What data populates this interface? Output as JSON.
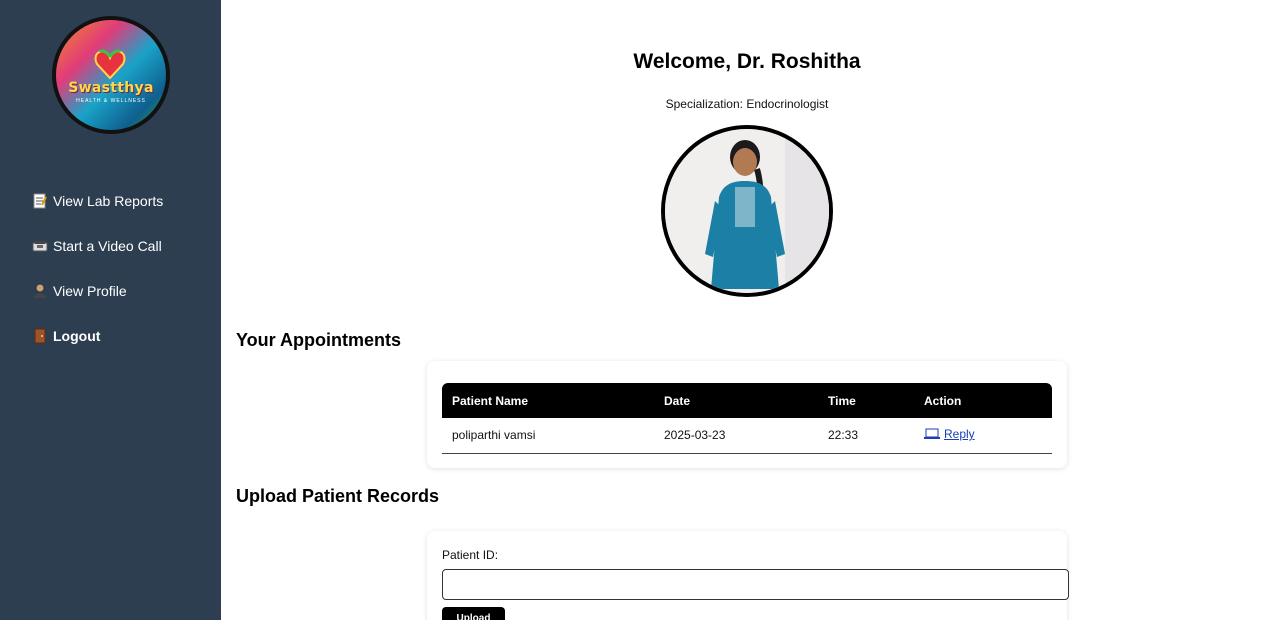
{
  "sidebar": {
    "logo": {
      "brand": "Swastthya",
      "tagline": "HEALTH & WELLNESS"
    },
    "items": [
      {
        "label": "View Lab Reports",
        "icon": "memo-icon"
      },
      {
        "label": "Start a Video Call",
        "icon": "video-call-icon"
      },
      {
        "label": "View Profile",
        "icon": "profile-icon"
      },
      {
        "label": "Logout",
        "icon": "door-icon"
      }
    ]
  },
  "header": {
    "welcome": "Welcome, Dr. Roshitha",
    "specialization": "Specialization: Endocrinologist"
  },
  "appointments": {
    "title": "Your Appointments",
    "columns": [
      "Patient Name",
      "Date",
      "Time",
      "Action"
    ],
    "rows": [
      {
        "patient": "poliparthi vamsi",
        "date": "2025-03-23",
        "time": "22:33",
        "action": "Reply"
      }
    ]
  },
  "upload": {
    "title": "Upload Patient Records",
    "patient_id_label": "Patient ID:",
    "patient_id_value": "",
    "button": "Upload"
  },
  "colors": {
    "sidebar_bg": "#2c3e50",
    "table_header_bg": "#000000",
    "link": "#1a3fb5"
  }
}
